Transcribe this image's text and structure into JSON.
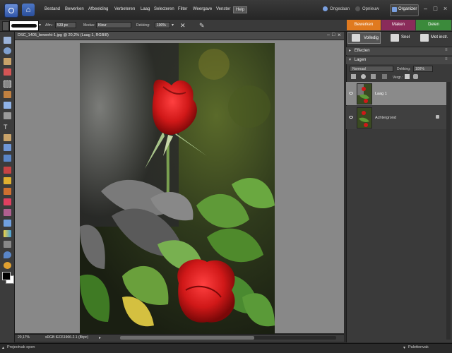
{
  "menubar": {
    "items": [
      "Bestand",
      "Bewerken",
      "Afbeelding",
      "Verbeteren",
      "Laag",
      "Selecteren",
      "Filter",
      "Weergave",
      "Venster",
      "Help"
    ],
    "undo_label": "Ongedaan",
    "redo_label": "Opnieuw",
    "organizer_label": "Organizer"
  },
  "options": {
    "size_label": "Afm.:",
    "size_value": "533 px",
    "mode_label": "Modus:",
    "mode_value": "Kleur",
    "opacity_label": "Dekking:",
    "opacity_value": "100%"
  },
  "mode_tabs": [
    "Bewerken",
    "Maken",
    "Delen"
  ],
  "view_tabs": [
    "Volledig",
    "Snel",
    "Met instr."
  ],
  "document": {
    "title": "DSC_1405_bewerkt-1.jpg @ 20,2% (Laag 1, RGB/8)",
    "zoom": "20,17%",
    "profile": "sRGB IEC61966-2.1 (8bpc)"
  },
  "panels": {
    "effects": "Effecten",
    "layers": "Lagen",
    "blend_mode": "Normaal",
    "opacity_label": "Dekking:",
    "opacity_value": "100%",
    "lock_label": "Vergr.:",
    "layers_list": [
      {
        "name": "Laag 1",
        "selected": true
      },
      {
        "name": "Achtergrond",
        "selected": false
      }
    ]
  },
  "status": {
    "project_bin": "Projectvak open",
    "palette_bin": "Palettenvak"
  },
  "colors": {
    "edit_tab": "#e07a1f",
    "create_tab": "#8a2b5a",
    "share_tab": "#3b8a3b",
    "foreground": "#000000",
    "background": "#ffffff"
  }
}
